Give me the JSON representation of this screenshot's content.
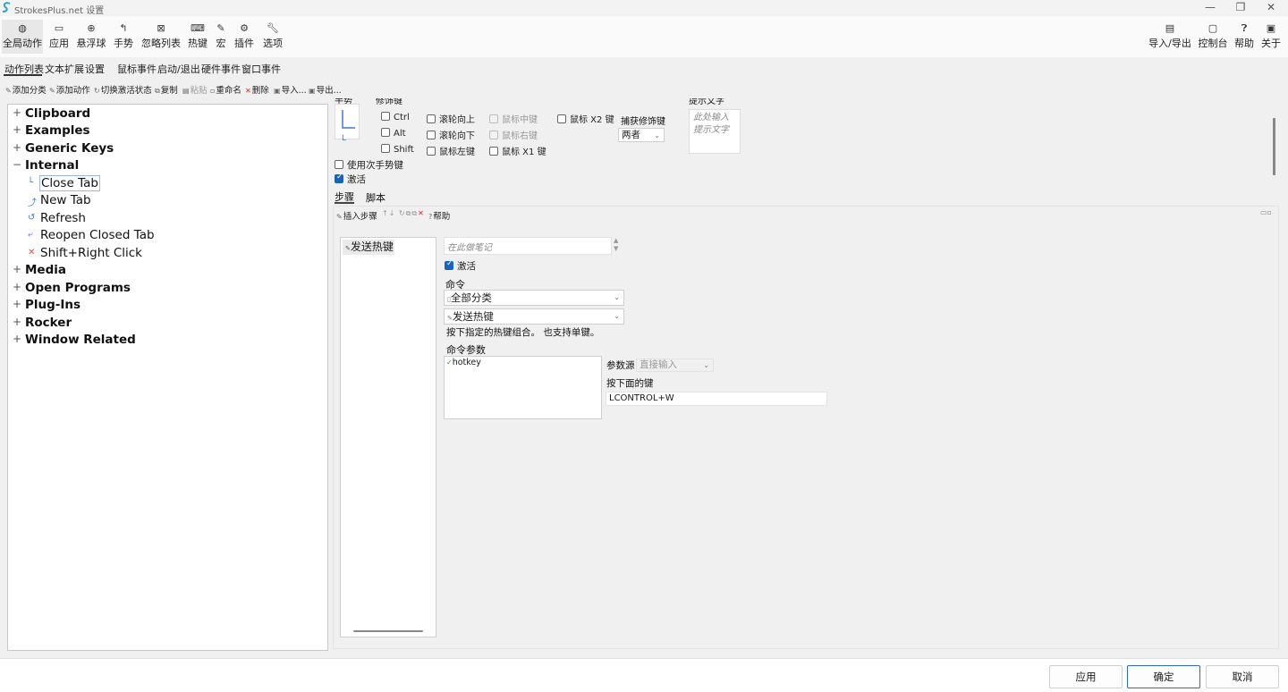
{
  "window": {
    "title": "StrokesPlus.net 设置",
    "controls": [
      "minimize-icon",
      "restore-icon",
      "close-icon"
    ]
  },
  "toolbar": {
    "left": [
      {
        "label": "全局动作",
        "icon": "globe-icon"
      },
      {
        "label": "应用",
        "icon": "window-icon"
      },
      {
        "label": "悬浮球",
        "icon": "crosshair-icon"
      },
      {
        "label": "手势",
        "icon": "gesture-icon"
      },
      {
        "label": "忽略列表",
        "icon": "ignore-list-icon"
      },
      {
        "label": "热键",
        "icon": "keyboard-icon"
      },
      {
        "label": "宏",
        "icon": "macro-icon"
      },
      {
        "label": "插件",
        "icon": "plugin-icon"
      },
      {
        "label": "选项",
        "icon": "wrench-icon"
      }
    ],
    "right": [
      {
        "label": "导入/导出",
        "icon": "import-export-icon"
      },
      {
        "label": "控制台",
        "icon": "console-icon"
      },
      {
        "label": "帮助",
        "icon": "help-icon"
      },
      {
        "label": "关于",
        "icon": "about-icon"
      }
    ]
  },
  "tabs": [
    "动作列表",
    "文本扩展",
    "设置",
    "鼠标事件",
    "启动/退出",
    "硬件事件",
    "窗口事件"
  ],
  "subtoolbar": [
    {
      "label": "添加分类",
      "enabled": true
    },
    {
      "label": "添加动作",
      "enabled": true
    },
    {
      "label": "切换激活状态",
      "enabled": true
    },
    {
      "label": "复制",
      "enabled": true
    },
    {
      "label": "粘贴",
      "enabled": false
    },
    {
      "label": "重命名",
      "enabled": true
    },
    {
      "label": "删除",
      "enabled": true
    },
    {
      "label": "导入...",
      "enabled": true
    },
    {
      "label": "导出...",
      "enabled": true
    }
  ],
  "tree": {
    "categories_before": [
      "Clipboard",
      "Examples",
      "Generic Keys"
    ],
    "expanded": {
      "label": "Internal",
      "items": [
        "Close Tab",
        "New Tab",
        "Refresh",
        "Reopen Closed Tab",
        "Shift+Right Click"
      ]
    },
    "categories_after": [
      "Media",
      "Open Programs",
      "Plug-Ins",
      "Rocker",
      "Window Related"
    ]
  },
  "action": {
    "gesture_label": "手势",
    "modifiers_label": "修饰键",
    "modifiers": [
      {
        "label": "Ctrl",
        "checked": false,
        "enabled": true
      },
      {
        "label": "Alt",
        "checked": false,
        "enabled": true
      },
      {
        "label": "Shift",
        "checked": false,
        "enabled": true
      },
      {
        "label": "滚轮向上",
        "checked": false,
        "enabled": true
      },
      {
        "label": "滚轮向下",
        "checked": false,
        "enabled": true
      },
      {
        "label": "鼠标左键",
        "checked": false,
        "enabled": true
      },
      {
        "label": "鼠标中键",
        "checked": false,
        "enabled": false
      },
      {
        "label": "鼠标右键",
        "checked": false,
        "enabled": false
      },
      {
        "label": "鼠标 X1 键",
        "checked": false,
        "enabled": true
      },
      {
        "label": "鼠标 X2 键",
        "checked": false,
        "enabled": true
      }
    ],
    "capture_label": "捕获修饰键",
    "capture_value": "两者",
    "tooltip_label": "提示文字",
    "tooltip_placeholder": "此处输入提示文字",
    "use_secondary": "使用次手势键",
    "activate": "激活",
    "sub_tabs": [
      "步骤",
      "脚本"
    ]
  },
  "steps": {
    "toolbar": {
      "insert": "插入步骤",
      "help": "帮助"
    },
    "list": [
      "发送热键"
    ],
    "note_placeholder": "在此做笔记",
    "activate": "激活",
    "command_label": "命令",
    "category_value": "全部分类",
    "command_value": "发送热键",
    "description": "按下指定的热键组合。 也支持单键。",
    "params_label": "命令参数",
    "params": [
      "hotkey"
    ],
    "source_label": "参数源",
    "source_value": "直接输入",
    "keys_label": "按下面的键",
    "keys_value": "LCONTROL+W"
  },
  "buttons": {
    "apply": "应用",
    "ok": "确定",
    "cancel": "取消"
  }
}
